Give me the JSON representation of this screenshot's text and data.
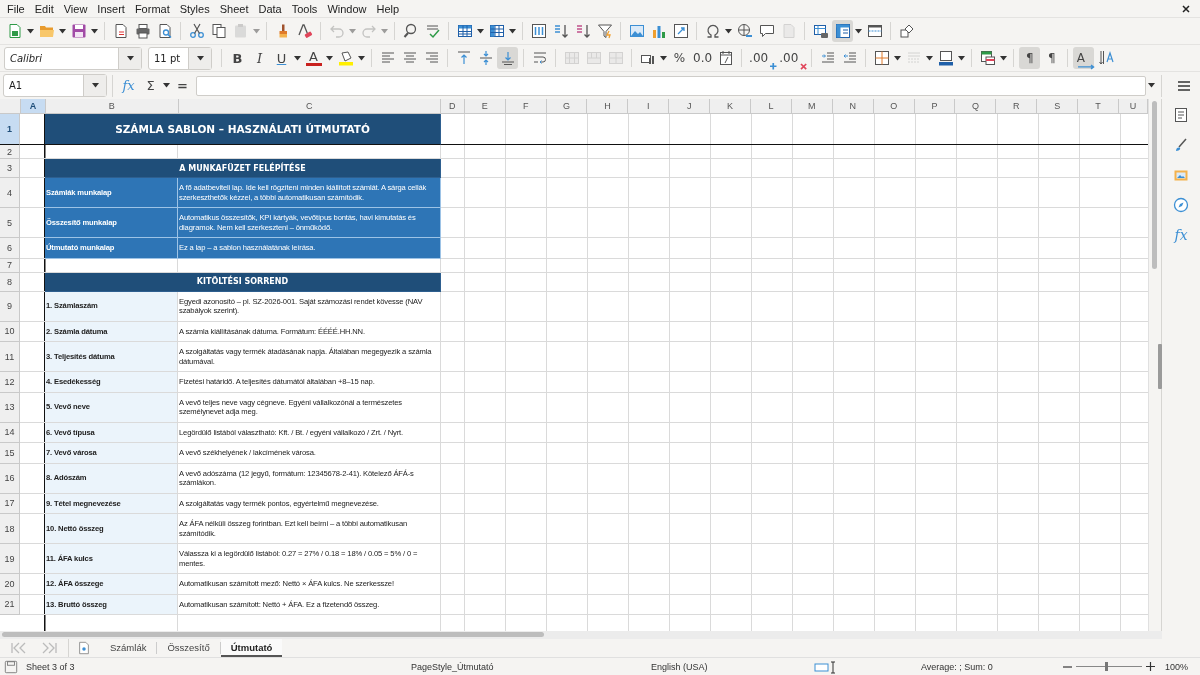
{
  "menu": [
    "File",
    "Edit",
    "View",
    "Insert",
    "Format",
    "Styles",
    "Sheet",
    "Data",
    "Tools",
    "Window",
    "Help"
  ],
  "standard_toolbar": [
    {
      "disabled": false,
      "pressed": false
    },
    {
      "disabled": false,
      "pressed": false
    },
    {
      "disabled": false,
      "pressed": false
    },
    {
      "disabled": false,
      "pressed": false
    },
    {
      "disabled": false,
      "pressed": false
    },
    {
      "disabled": false,
      "pressed": false
    },
    {
      "disabled": false,
      "pressed": false
    },
    {
      "disabled": false,
      "pressed": false
    },
    {
      "disabled": true,
      "pressed": false
    },
    {
      "disabled": false,
      "pressed": false
    },
    {
      "disabled": false,
      "pressed": false
    },
    {
      "disabled": true,
      "pressed": false
    },
    {
      "disabled": true,
      "pressed": false
    },
    {
      "disabled": false,
      "pressed": false
    },
    {
      "disabled": false,
      "pressed": false
    },
    {
      "disabled": false,
      "pressed": false
    },
    {
      "disabled": false,
      "pressed": false
    },
    {
      "disabled": false,
      "pressed": false
    },
    {
      "disabled": false,
      "pressed": false
    },
    {
      "disabled": false,
      "pressed": false
    },
    {
      "disabled": false,
      "pressed": false
    },
    {
      "disabled": false,
      "pressed": false
    },
    {
      "disabled": false,
      "pressed": false
    },
    {
      "disabled": false,
      "pressed": false
    },
    {
      "disabled": false,
      "pressed": false
    },
    {
      "disabled": false,
      "pressed": false
    },
    {
      "disabled": false,
      "pressed": false
    },
    {
      "disabled": true,
      "pressed": false
    },
    {
      "disabled": false,
      "pressed": false
    },
    {
      "disabled": false,
      "pressed": true
    },
    {
      "disabled": false,
      "pressed": false
    },
    {
      "disabled": false,
      "pressed": false
    }
  ],
  "formatting_toolbar": {
    "font_name": "Calibri",
    "font_size": "11 pt",
    "buttons": [
      {
        "label": "B",
        "disabled": false,
        "pressed": false
      },
      {
        "label": "I",
        "disabled": false,
        "pressed": false
      },
      {
        "label": "U",
        "disabled": false,
        "pressed": false
      },
      {
        "label": "A",
        "disabled": false,
        "pressed": false
      },
      {
        "disabled": false,
        "pressed": false
      },
      {
        "disabled": false,
        "pressed": false
      },
      {
        "disabled": false,
        "pressed": false
      },
      {
        "disabled": false,
        "pressed": false
      },
      {
        "disabled": false,
        "pressed": false
      },
      {
        "disabled": false,
        "pressed": false
      },
      {
        "disabled": false,
        "pressed": true
      },
      {
        "disabled": false,
        "pressed": false
      },
      {
        "disabled": true,
        "pressed": false
      },
      {
        "disabled": true,
        "pressed": false
      },
      {
        "disabled": true,
        "pressed": false
      },
      {
        "disabled": false,
        "pressed": false
      },
      {
        "label": "%",
        "disabled": false,
        "pressed": false
      },
      {
        "label": "0.0",
        "disabled": false,
        "pressed": false
      },
      {
        "disabled": false,
        "pressed": false
      },
      {
        "label": ".00",
        "disabled": false,
        "pressed": false
      },
      {
        "label": ".00",
        "disabled": false,
        "pressed": false
      },
      {
        "disabled": false,
        "pressed": false
      },
      {
        "disabled": false,
        "pressed": false
      },
      {
        "disabled": false,
        "pressed": false
      },
      {
        "disabled": true,
        "pressed": false
      },
      {
        "disabled": false,
        "pressed": false
      },
      {
        "disabled": false,
        "pressed": false
      },
      {
        "label": "¶",
        "disabled": false,
        "pressed": true
      },
      {
        "label": "¶",
        "disabled": false,
        "pressed": false
      },
      {
        "label": "A",
        "disabled": false,
        "pressed": true
      },
      {
        "disabled": false,
        "pressed": false
      }
    ]
  },
  "formula_bar": {
    "name_box": "A1",
    "function_wizard": "fx",
    "sum": "Σ",
    "equals": "="
  },
  "sidebar": {
    "functions": "fx"
  },
  "columns": [
    {
      "label": "A",
      "selected": true
    },
    {
      "label": "B",
      "selected": false
    },
    {
      "label": "C",
      "selected": false
    },
    {
      "label": "D",
      "selected": false
    },
    {
      "label": "E",
      "selected": false
    },
    {
      "label": "F",
      "selected": false
    },
    {
      "label": "G",
      "selected": false
    },
    {
      "label": "H",
      "selected": false
    },
    {
      "label": "I",
      "selected": false
    },
    {
      "label": "J",
      "selected": false
    },
    {
      "label": "K",
      "selected": false
    },
    {
      "label": "L",
      "selected": false
    },
    {
      "label": "M",
      "selected": false
    },
    {
      "label": "N",
      "selected": false
    },
    {
      "label": "O",
      "selected": false
    },
    {
      "label": "P",
      "selected": false
    },
    {
      "label": "Q",
      "selected": false
    },
    {
      "label": "R",
      "selected": false
    },
    {
      "label": "S",
      "selected": false
    },
    {
      "label": "T",
      "selected": false
    },
    {
      "label": "U",
      "selected": false
    }
  ],
  "rows": [
    {
      "number": "1",
      "selected": true,
      "kind": "title",
      "text": "SZÁMLA SABLON – HASZNÁLATI ÚTMUTATÓ"
    },
    {
      "number": "2",
      "selected": false,
      "kind": "blank"
    },
    {
      "number": "3",
      "selected": false,
      "kind": "section",
      "text": "A MUNKAFÜZET FELÉPÍTÉSE"
    },
    {
      "number": "4",
      "selected": false,
      "kind": "sheet_info",
      "label": "Számlák munkalap",
      "description": "A fő adatbeviteli lap. Ide kell rögzíteni minden kiállított számlát. A sárga cellák szerkeszthetők kézzel, a többi automatikusan számítódik."
    },
    {
      "number": "5",
      "selected": false,
      "kind": "sheet_info",
      "label": "Összesítő munkalap",
      "description": "Automatikus összesítők, KPI kártyák, vevőtípus bontás, havi kimutatás és diagramok. Nem kell szerkeszteni – önműködő."
    },
    {
      "number": "6",
      "selected": false,
      "kind": "sheet_info",
      "label": "Útmutató munkalap",
      "description": "Ez a lap – a sablon használatának leírása."
    },
    {
      "number": "7",
      "selected": false,
      "kind": "blank"
    },
    {
      "number": "8",
      "selected": false,
      "kind": "section",
      "text": "KITÖLTÉSI SORREND"
    },
    {
      "number": "9",
      "selected": false,
      "kind": "step",
      "label": "1. Számlaszám",
      "description": "Egyedi azonosító – pl. SZ-2026-001. Saját számozási rendet kövesse (NAV szabályok szerint)."
    },
    {
      "number": "10",
      "selected": false,
      "kind": "step",
      "label": "2. Számla dátuma",
      "description": "A számla kiállításának dátuma. Formátum: ÉÉÉÉ.HH.NN."
    },
    {
      "number": "11",
      "selected": false,
      "kind": "step",
      "label": "3. Teljesítés dátuma",
      "description": "A szolgáltatás vagy termék átadásának napja. Általában megegyezik a számla dátumával."
    },
    {
      "number": "12",
      "selected": false,
      "kind": "step",
      "label": "4. Esedékesség",
      "description": "Fizetési határidő. A teljesítés dátumától általában +8–15 nap."
    },
    {
      "number": "13",
      "selected": false,
      "kind": "step",
      "label": "5. Vevő neve",
      "description": "A vevő teljes neve vagy cégneve. Egyéni vállalkozónál a természetes személynevet adja meg."
    },
    {
      "number": "14",
      "selected": false,
      "kind": "step",
      "label": "6. Vevő típusa",
      "description": "Legördülő listából választható: Kft. / Bt. / egyéni vállalkozó / Zrt. / Nyrt."
    },
    {
      "number": "15",
      "selected": false,
      "kind": "step",
      "label": "7. Vevő városa",
      "description": "A vevő székhelyének / lakcímének városa."
    },
    {
      "number": "16",
      "selected": false,
      "kind": "step",
      "label": "8. Adószám",
      "description": "A vevő adószáma (12 jegyű, formátum: 12345678-2-41). Kötelező ÁFÁ-s számlákon."
    },
    {
      "number": "17",
      "selected": false,
      "kind": "step",
      "label": "9. Tétel megnevezése",
      "description": "A szolgáltatás vagy termék pontos, egyértelmű megnevezése."
    },
    {
      "number": "18",
      "selected": false,
      "kind": "step",
      "label": "10. Nettó összeg",
      "description": "Az ÁFA nélküli összeg forintban. Ezt kell beírni – a többi automatikusan számítódik."
    },
    {
      "number": "19",
      "selected": false,
      "kind": "step",
      "label": "11. ÁFA kulcs",
      "description": "Válassza ki a legördülő listából: 0.27 = 27% / 0.18 = 18% / 0.05 = 5% / 0 = mentes."
    },
    {
      "number": "20",
      "selected": false,
      "kind": "step",
      "label": "12. ÁFA összege",
      "description": "Automatikusan számított mező: Nettó × ÁFA kulcs. Ne szerkessze!"
    },
    {
      "number": "21",
      "selected": false,
      "kind": "step",
      "label": "13. Bruttó összeg",
      "description": "Automatikusan számított: Nettó + ÁFA. Ez a fizetendő összeg."
    }
  ],
  "sheet_tabs": [
    {
      "label": "Számlák",
      "selected": false
    },
    {
      "label": "Összesítő",
      "selected": false
    },
    {
      "label": "Útmutató",
      "selected": true
    }
  ],
  "status_bar": {
    "sheet": "Sheet 3 of 3",
    "page_style": "PageStyle_Útmutató",
    "language": "English (USA)",
    "summary": "Average: ; Sum: 0",
    "zoom": {
      "level": 0.46,
      "reading": "100%"
    }
  }
}
